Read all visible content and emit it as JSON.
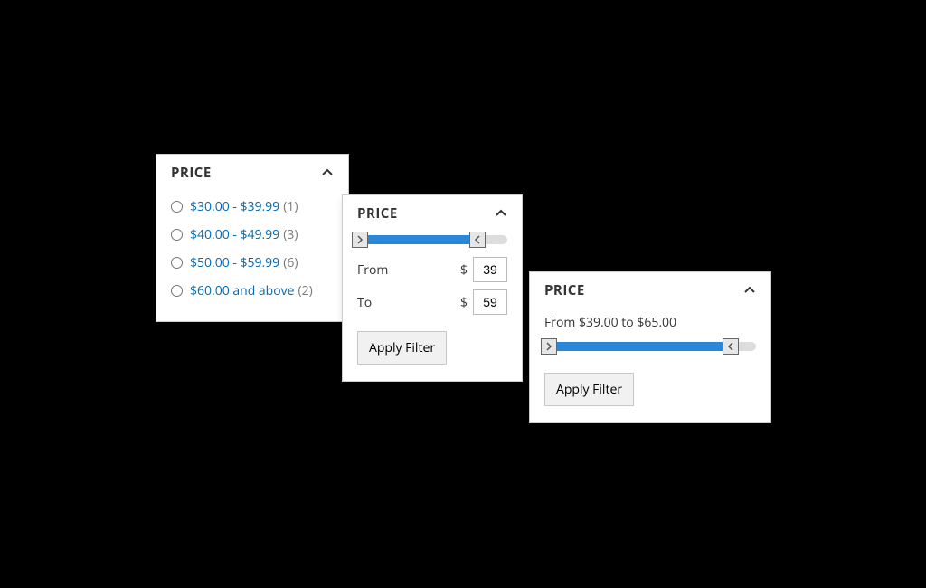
{
  "card1": {
    "title": "PRICE",
    "options": [
      {
        "label": "$30.00 - $39.99",
        "count": "(1)"
      },
      {
        "label": "$40.00 - $49.99",
        "count": "(3)"
      },
      {
        "label": "$50.00 - $59.99",
        "count": "(6)"
      },
      {
        "label": "$60.00 and above",
        "count": "(2)"
      }
    ]
  },
  "card2": {
    "title": "PRICE",
    "from_label": "From",
    "to_label": "To",
    "currency": "$",
    "from_value": "39",
    "to_value": "59",
    "apply_label": "Apply Filter",
    "slider": {
      "min_pct": 2,
      "max_pct": 80
    }
  },
  "card3": {
    "title": "PRICE",
    "range_text": "From $39.00 to $65.00",
    "apply_label": "Apply Filter",
    "slider": {
      "min_pct": 2,
      "max_pct": 88
    }
  }
}
